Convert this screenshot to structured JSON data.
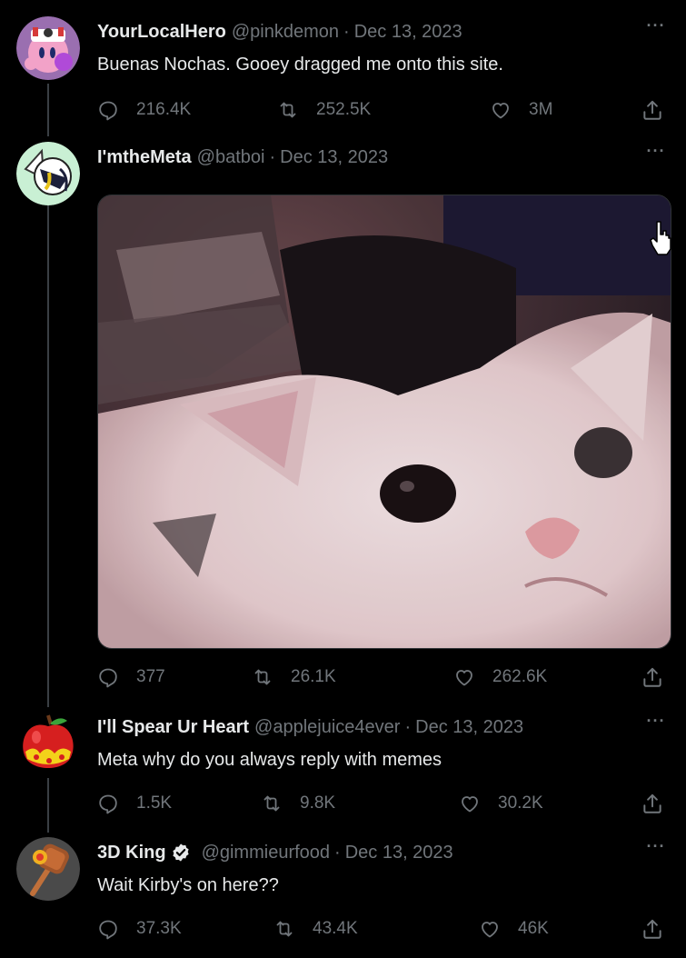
{
  "tweets": [
    {
      "name": "YourLocalHero",
      "handle": "@pinkdemon",
      "date": "Dec 13, 2023",
      "text": "Buenas Nochas. Gooey dragged me onto this site.",
      "replies": "216.4K",
      "retweets": "252.5K",
      "likes": "3M"
    },
    {
      "name": "I'mtheMeta",
      "handle": "@batboi",
      "date": "Dec 13, 2023",
      "text": "",
      "replies": "377",
      "retweets": "26.1K",
      "likes": "262.6K"
    },
    {
      "name": "I'll Spear Ur Heart",
      "handle": "@applejuice4ever",
      "date": "Dec 13, 2023",
      "text": "Meta why do you always reply with memes",
      "replies": "1.5K",
      "retweets": "9.8K",
      "likes": "30.2K"
    },
    {
      "name": "3D King",
      "handle": "@gimmieurfood",
      "date": "Dec 13, 2023",
      "text": "Wait Kirby's on here??",
      "replies": "37.3K",
      "retweets": "43.4K",
      "likes": "46K",
      "verified": true
    }
  ],
  "separator": "·",
  "more_label": "···",
  "colors": {
    "background": "#000000",
    "text": "#e7e9ea",
    "muted": "#71767b",
    "thread_line": "#3a3f44",
    "verified_badge": "#e7e9ea"
  },
  "icons": [
    "reply-icon",
    "retweet-icon",
    "like-icon",
    "share-icon",
    "more-icon",
    "verified-icon",
    "pointer-cursor-icon"
  ]
}
